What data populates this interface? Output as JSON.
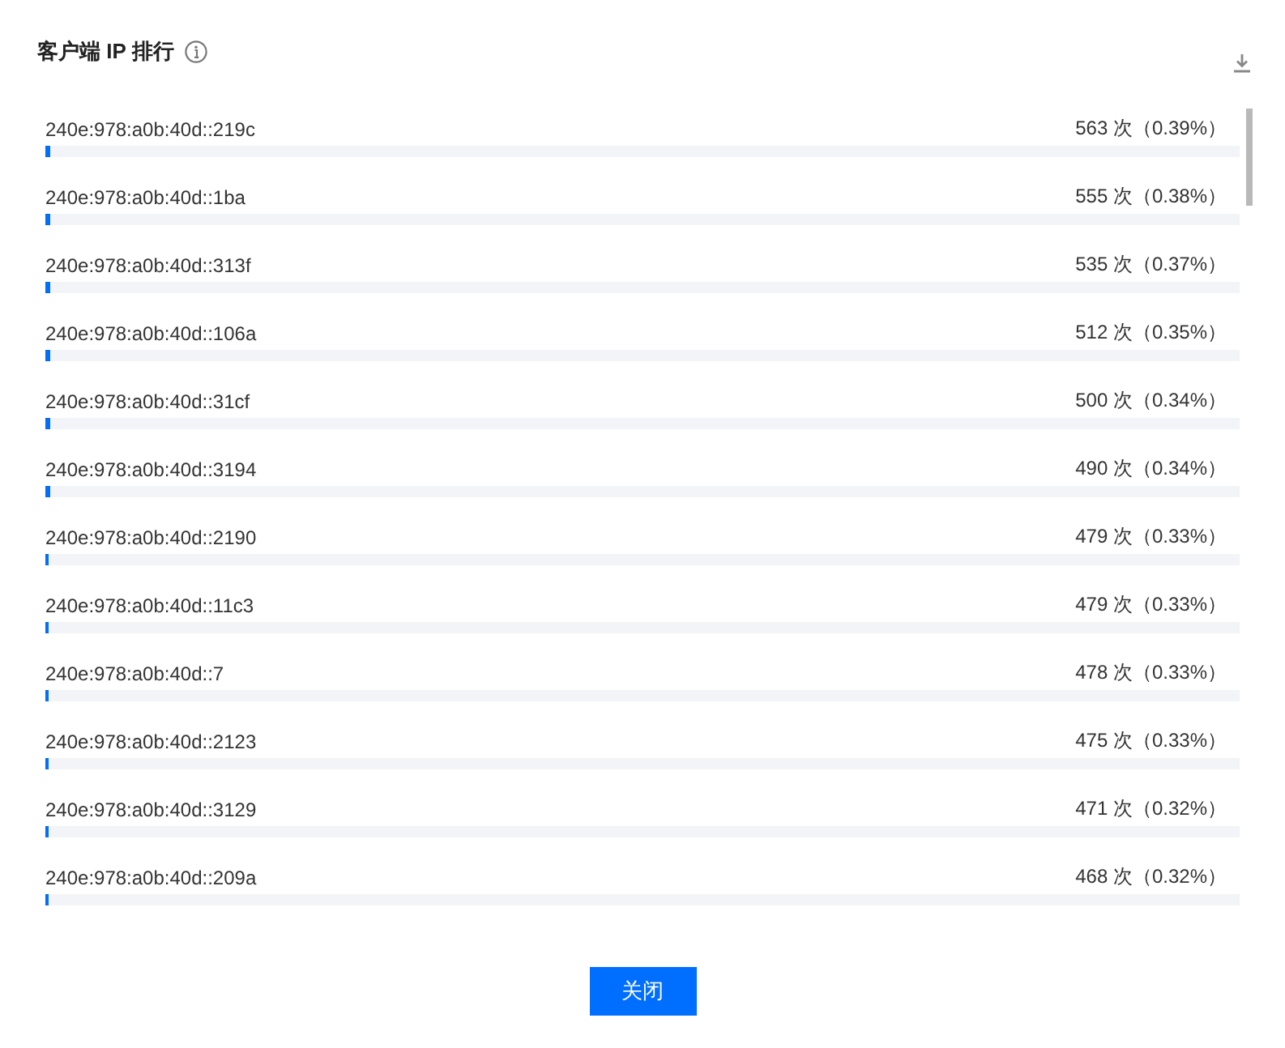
{
  "dialog": {
    "title": "客户端 IP 排行",
    "items": [
      {
        "ip": "240e:978:a0b:40d::219c",
        "count": "563 次（0.39%）",
        "level": 0.0039
      },
      {
        "ip": "240e:978:a0b:40d::1ba",
        "count": "555 次（0.38%）",
        "level": 0.0038
      },
      {
        "ip": "240e:978:a0b:40d::313f",
        "count": "535 次（0.37%）",
        "level": 0.0037
      },
      {
        "ip": "240e:978:a0b:40d::106a",
        "count": "512 次（0.35%）",
        "level": 0.0035
      },
      {
        "ip": "240e:978:a0b:40d::31cf",
        "count": "500 次（0.34%）",
        "level": 0.0034
      },
      {
        "ip": "240e:978:a0b:40d::3194",
        "count": "490 次（0.34%）",
        "level": 0.0034
      },
      {
        "ip": "240e:978:a0b:40d::2190",
        "count": "479 次（0.33%）",
        "level": 0.0033
      },
      {
        "ip": "240e:978:a0b:40d::11c3",
        "count": "479 次（0.33%）",
        "level": 0.0033
      },
      {
        "ip": "240e:978:a0b:40d::7",
        "count": "478 次（0.33%）",
        "level": 0.0033
      },
      {
        "ip": "240e:978:a0b:40d::2123",
        "count": "475 次（0.33%）",
        "level": 0.0033
      },
      {
        "ip": "240e:978:a0b:40d::3129",
        "count": "471 次（0.32%）",
        "level": 0.0032
      },
      {
        "ip": "240e:978:a0b:40d::209a",
        "count": "468 次（0.32%）",
        "level": 0.0032
      }
    ],
    "buttons": [
      {
        "label": "关闭"
      }
    ]
  }
}
